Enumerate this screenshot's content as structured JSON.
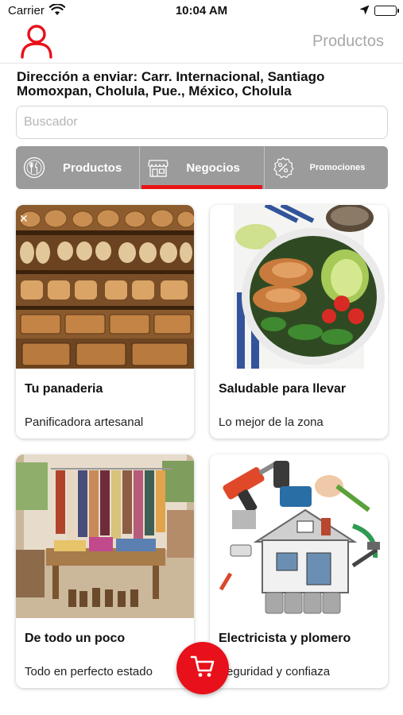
{
  "status_bar": {
    "carrier": "Carrier",
    "time": "10:04 AM",
    "icons": [
      "wifi-icon",
      "location-arrow-icon",
      "battery-icon"
    ]
  },
  "nav": {
    "title": "Productos",
    "profile_icon": "user-icon"
  },
  "address": "Dirección a enviar: Carr. Internacional, Santiago Momoxpan, Cholula, Pue., México, Cholula",
  "search": {
    "placeholder": "Buscador",
    "value": ""
  },
  "segments": [
    {
      "label": "Productos",
      "icon": "utensils-icon",
      "active": false
    },
    {
      "label": "Negocios",
      "icon": "storefront-icon",
      "active": true
    },
    {
      "label": "Promociones",
      "icon": "discount-badge-icon",
      "active": false
    }
  ],
  "cards": [
    {
      "title": "Tu panaderia",
      "subtitle": "Panificadora artesanal",
      "image": "bakery-shelves-photo"
    },
    {
      "title": "Saludable para llevar",
      "subtitle": "Lo mejor de la zona",
      "image": "salad-bowl-photo"
    },
    {
      "title": "De todo un poco",
      "subtitle": "Todo en perfecto estado",
      "image": "second-hand-market-photo"
    },
    {
      "title": "Electricista y plomero",
      "subtitle": "Seguridad y confiaza",
      "image": "house-tools-photo"
    }
  ],
  "fab": {
    "icon": "shopping-cart-icon"
  },
  "colors": {
    "accent": "#e8101a",
    "segment_bg": "#9b9b9b",
    "nav_title": "#a8a8a8"
  }
}
